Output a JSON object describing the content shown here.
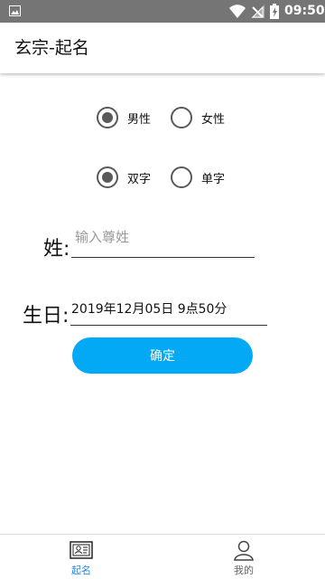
{
  "status_bar": {
    "time": "09:50",
    "icons": [
      "gallery-icon",
      "wifi-icon",
      "signal-icon",
      "battery-icon"
    ]
  },
  "app_bar": {
    "title": "玄宗-起名"
  },
  "gender": {
    "options": [
      {
        "label": "男性",
        "checked": true
      },
      {
        "label": "女性",
        "checked": false
      }
    ]
  },
  "name_length": {
    "options": [
      {
        "label": "双字",
        "checked": true
      },
      {
        "label": "单字",
        "checked": false
      }
    ]
  },
  "surname": {
    "label": "姓:",
    "placeholder": "输入尊姓",
    "value": ""
  },
  "birthday": {
    "label": "生日:",
    "value": "2019年12月05日 9点50分"
  },
  "confirm_button": {
    "label": "确定"
  },
  "bottom_nav": {
    "items": [
      {
        "label": "起名",
        "icon": "name-card-icon",
        "active": true
      },
      {
        "label": "我的",
        "icon": "profile-icon",
        "active": false
      }
    ]
  },
  "colors": {
    "status_bar": "#757575",
    "accent": "#03a9f4",
    "active_nav": "#1e88e5",
    "radio": "#5a5a5a"
  }
}
